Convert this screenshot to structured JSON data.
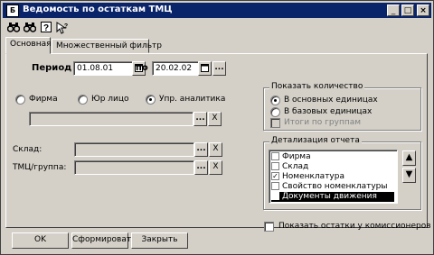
{
  "window": {
    "title": "Ведомость по остаткам ТМЦ",
    "min": "_",
    "max": "□",
    "close": "×"
  },
  "toolbar": {
    "icons": [
      "binoculars-icon",
      "binoculars-forward-icon",
      "help-icon",
      "context-help-icon"
    ]
  },
  "tabs": [
    {
      "label": "Основная"
    },
    {
      "label": "Множественный фильтр"
    }
  ],
  "period": {
    "label": "Период с",
    "from": "01.08.01",
    "to_label": "по",
    "to": "20.02.02",
    "extra_btn": "..."
  },
  "analytics": {
    "options": [
      {
        "label": "Фирма",
        "selected": false
      },
      {
        "label": "Юр лицо",
        "selected": false
      },
      {
        "label": "Упр. аналитика",
        "selected": true
      }
    ],
    "value": "",
    "pick": "...",
    "clear": "X"
  },
  "sklad": {
    "label": "Склад:",
    "value": ""
  },
  "tmc": {
    "label": "ТМЦ/группа:",
    "value": ""
  },
  "qty": {
    "title": "Показать количество",
    "options": [
      {
        "label": "В основных единицах",
        "selected": true
      },
      {
        "label": "В базовых единицах",
        "selected": false
      }
    ],
    "totals": "Итоги по группам"
  },
  "detail": {
    "title": "Детализация отчета",
    "items": [
      {
        "label": "Фирма",
        "checked": false,
        "selected": false
      },
      {
        "label": "Склад",
        "checked": false,
        "selected": false
      },
      {
        "label": "Номенклатура",
        "checked": true,
        "selected": false
      },
      {
        "label": "Свойство номенклатуры",
        "checked": false,
        "selected": false
      },
      {
        "label": "Документы движения",
        "checked": false,
        "selected": true
      }
    ],
    "up": "▲",
    "down": "▼"
  },
  "commission": {
    "label": "Показать остатки у комиссионеров",
    "checked": false
  },
  "buttons": {
    "ok": "OK",
    "form": "Сформировать",
    "close": "Закрыть"
  }
}
